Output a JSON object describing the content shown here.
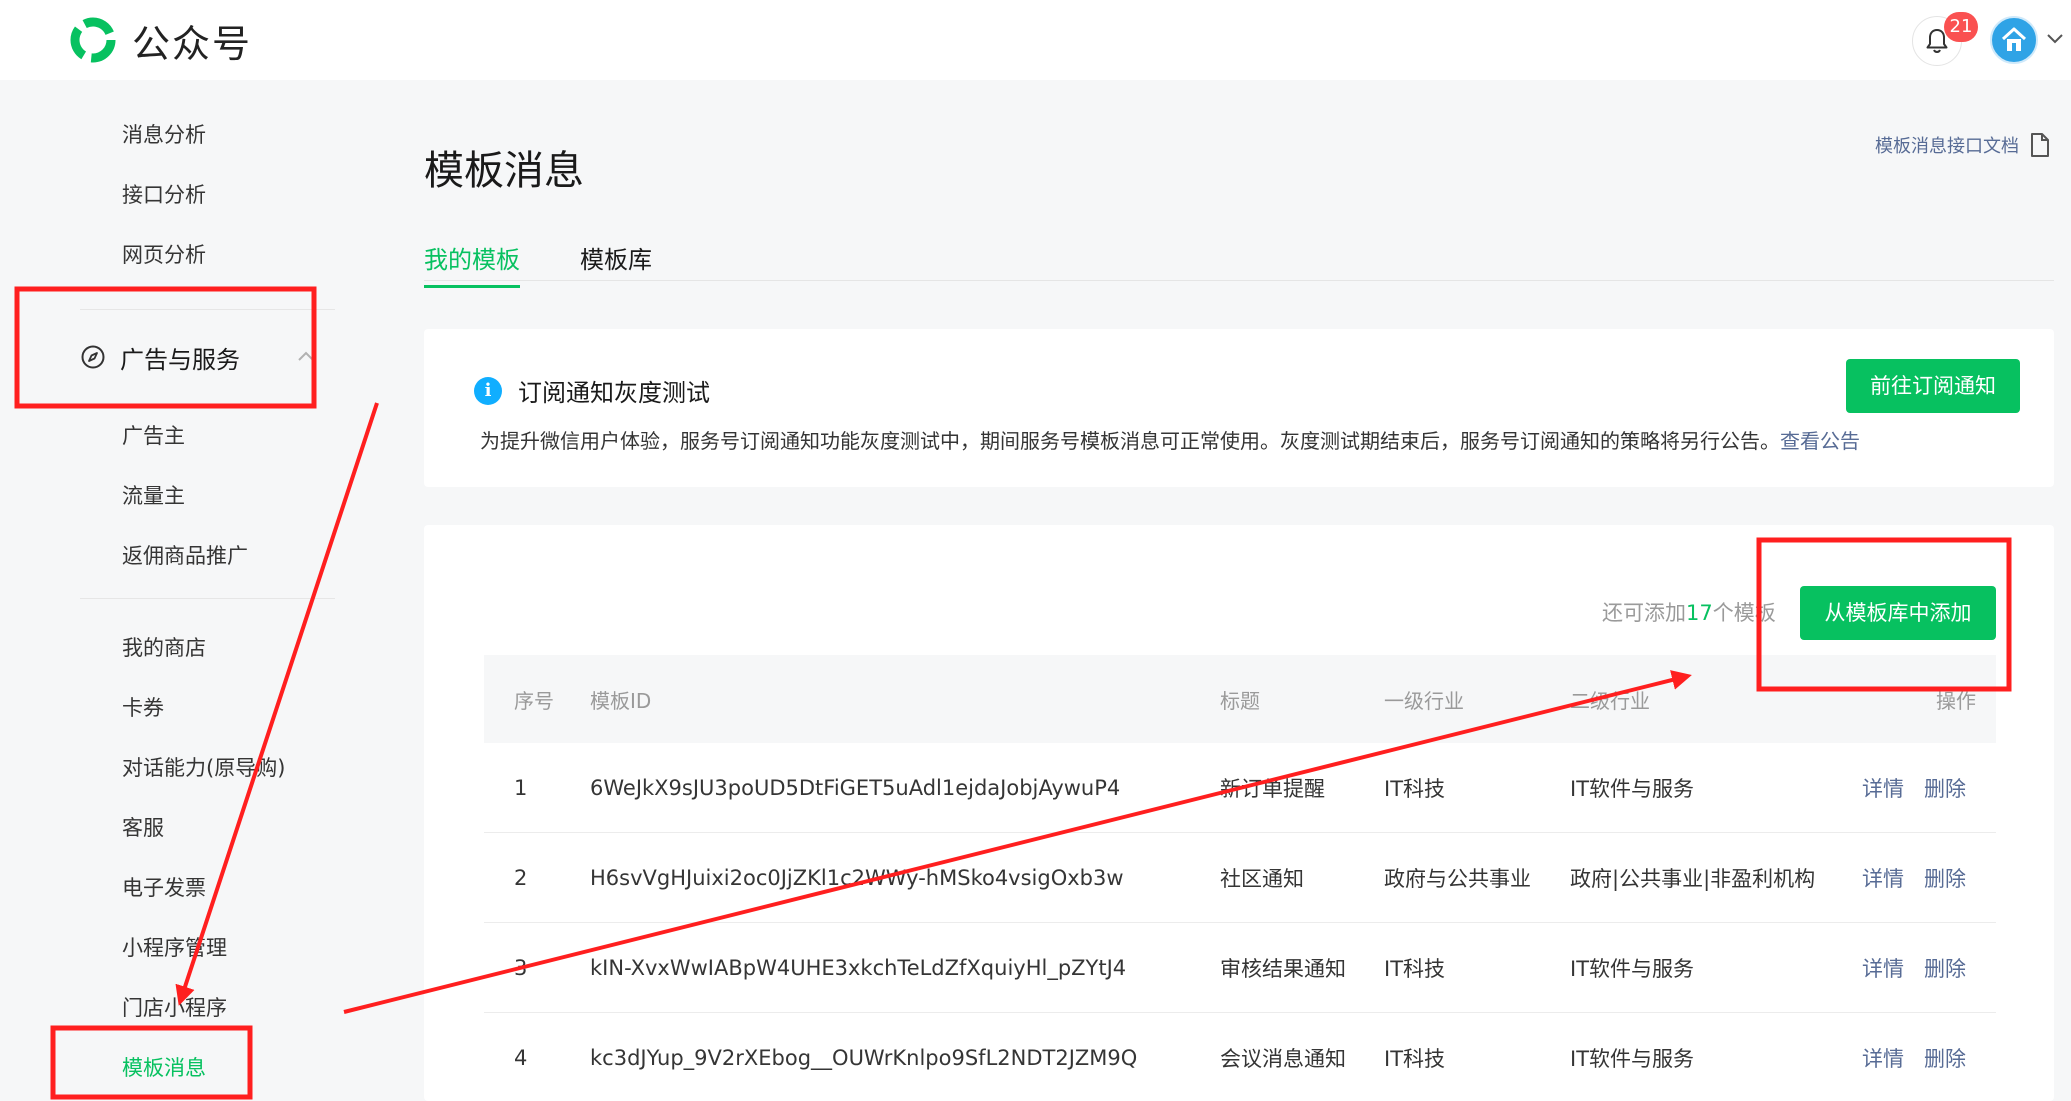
{
  "app": {
    "name": "公众号",
    "notification_count": "21",
    "brand_color": "#07c160"
  },
  "sidebar": {
    "items_top": [
      {
        "label": "消息分析"
      },
      {
        "label": "接口分析"
      },
      {
        "label": "网页分析"
      }
    ],
    "group": {
      "label": "广告与服务",
      "icon": "compass-icon"
    },
    "items_group": [
      {
        "label": "广告主"
      },
      {
        "label": "流量主"
      },
      {
        "label": "返佣商品推广"
      }
    ],
    "items_bottom": [
      {
        "label": "我的商店"
      },
      {
        "label": "卡券"
      },
      {
        "label": "对话能力(原导购)"
      },
      {
        "label": "客服"
      },
      {
        "label": "电子发票"
      },
      {
        "label": "小程序管理"
      },
      {
        "label": "门店小程序"
      },
      {
        "label": "模板消息",
        "active": true
      }
    ]
  },
  "main": {
    "title": "模板消息",
    "doc_link": "模板消息接口文档",
    "tabs": [
      {
        "label": "我的模板",
        "active": true
      },
      {
        "label": "模板库"
      }
    ],
    "notice": {
      "title": "订阅通知灰度测试",
      "body": "为提升微信用户体验，服务号订阅通知功能灰度测试中，期间服务号模板消息可正常使用。灰度测试期结束后，服务号订阅通知的策略将另行公告。",
      "link": "查看公告",
      "button": "前往订阅通知"
    },
    "templates": {
      "quota_prefix": "还可添加",
      "quota_count": "17",
      "quota_suffix": "个模板",
      "add_button": "从模板库中添加",
      "columns": {
        "no": "序号",
        "id": "模板ID",
        "title": "标题",
        "industry1": "一级行业",
        "industry2": "二级行业",
        "actions": "操作"
      },
      "detail_label": "详情",
      "delete_label": "删除",
      "rows": [
        {
          "no": "1",
          "id": "6WeJkX9sJU3poUD5DtFiGET5uAdl1ejdaJobjAywuP4",
          "title": "新订单提醒",
          "industry1": "IT科技",
          "industry2": "IT软件与服务"
        },
        {
          "no": "2",
          "id": "H6svVgHJuixi2oc0JjZKl1c2WWy-hMSko4vsigOxb3w",
          "title": "社区通知",
          "industry1": "政府与公共事业",
          "industry2": "政府|公共事业|非盈利机构"
        },
        {
          "no": "3",
          "id": "kIN-XvxWwIABpW4UHE3xkchTeLdZfXquiyHl_pZYtJ4",
          "title": "审核结果通知",
          "industry1": "IT科技",
          "industry2": "IT软件与服务"
        },
        {
          "no": "4",
          "id": "kc3dJYup_9V2rXEbog__OUWrKnlpo9SfL2NDT2JZM9Q",
          "title": "会议消息通知",
          "industry1": "IT科技",
          "industry2": "IT软件与服务"
        }
      ]
    }
  },
  "annotation_color": "#ff1f1f"
}
